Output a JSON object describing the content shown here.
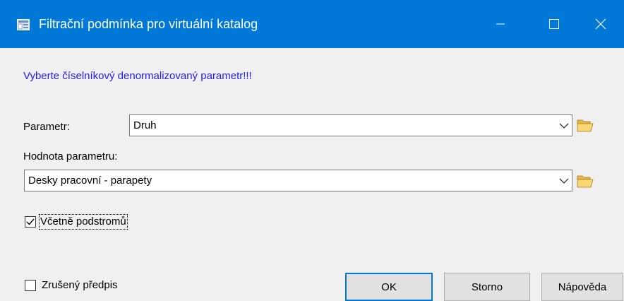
{
  "window": {
    "title": "Filtrační podmínka pro virtuální katalog"
  },
  "instruction": "Vyberte číselníkový denormalizovaný parametr!!!",
  "parameter": {
    "label": "Parametr:",
    "value": "Druh"
  },
  "parameter_value": {
    "label": "Hodnota parametru:",
    "value": "Desky pracovní - parapety"
  },
  "include_subtrees": {
    "label": "Včetně podstromů",
    "checked": true
  },
  "cancelled_rule": {
    "label": "Zrušený předpis",
    "checked": false
  },
  "buttons": {
    "ok": "OK",
    "cancel": "Storno",
    "help": "Nápověda"
  },
  "colors": {
    "titlebar": "#0078d7",
    "instruction_text": "#2020ff"
  },
  "icons": {
    "app": "app-icon",
    "minimize": "minimize-icon",
    "maximize": "maximize-icon",
    "close": "close-icon",
    "dropdown": "chevron-down-icon",
    "browse": "folder-open-icon"
  }
}
